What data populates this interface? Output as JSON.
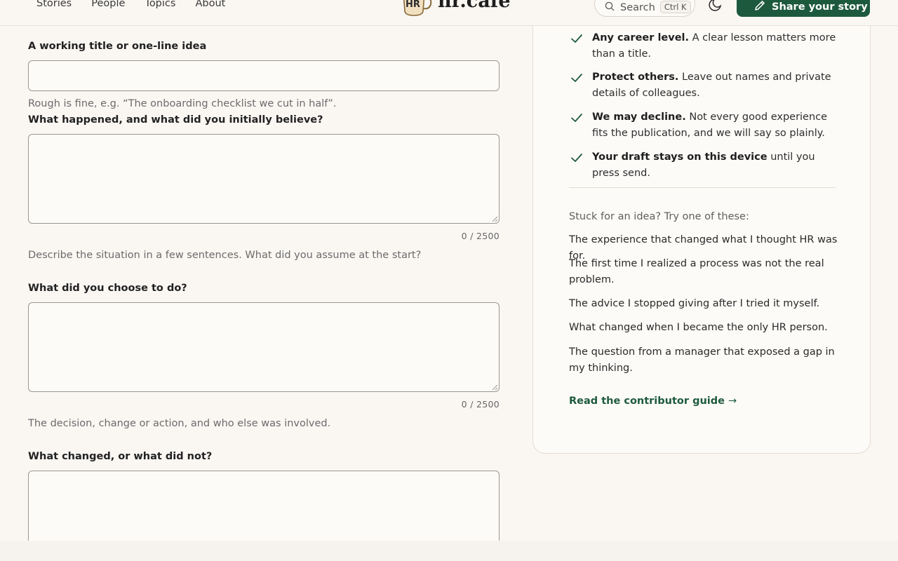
{
  "header": {
    "nav": [
      "Stories",
      "People",
      "Topics",
      "About"
    ],
    "logo_badge": "HR",
    "logo_text": "hr.cafe",
    "search_label": "Search",
    "search_shortcut": "Ctrl K",
    "share_label": "Share your story",
    "accent_color": "#1d5a3d"
  },
  "form": {
    "fields": [
      {
        "label": "A working title or one-line idea",
        "hint": "Rough is fine, e.g. “The onboarding checklist we cut in half”."
      },
      {
        "label": "What happened, and what did you initially believe?",
        "counter": "0 / 2500",
        "hint": "Describe the situation in a few sentences. What did you assume at the start?"
      },
      {
        "label": "What did you choose to do?",
        "counter": "0 / 2500",
        "hint": "The decision, change or action, and who else was involved."
      },
      {
        "label": "What changed, or what did not?"
      }
    ]
  },
  "sidebar": {
    "rules": [
      {
        "bold": "Any career level.",
        "text": " A clear lesson matters more than a title."
      },
      {
        "bold": "Protect others.",
        "text": " Leave out names and private details of colleagues."
      },
      {
        "bold": "We may decline.",
        "text": " Not every good experience fits the publication, and we will say so plainly."
      },
      {
        "bold": "Your draft stays on this device",
        "text": " until you press send."
      }
    ],
    "ideas_heading": "Stuck for an idea? Try one of these:",
    "ideas": [
      "The experience that changed what I thought HR was for.",
      "The first time I realized a process was not the real problem.",
      "The advice I stopped giving after I tried it myself.",
      "What changed when I became the only HR person.",
      "The question from a manager that exposed a gap in my thinking."
    ],
    "guide_link": "Read the contributor guide",
    "guide_arrow": "→"
  },
  "icons": [
    "search-icon",
    "moon-icon",
    "pencil-icon",
    "check-icon",
    "resize-handle-icon"
  ]
}
